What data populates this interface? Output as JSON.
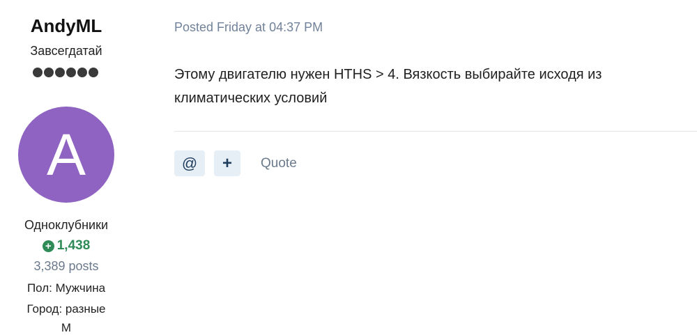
{
  "author": {
    "username": "AndyML",
    "rank": "Завсегдатай",
    "pip_count": 6,
    "avatar_letter": "A",
    "avatar_color": "#8e63c1",
    "group": "Одноклубники",
    "reputation": "1,438",
    "reputation_color": "#2e8b57",
    "posts": "3,389 posts",
    "fields": [
      {
        "label": "Пол:",
        "value": "Мужчина"
      },
      {
        "label": "Город:",
        "value": "разные"
      },
      {
        "label": "М",
        "value": ""
      }
    ]
  },
  "post": {
    "date": "Posted Friday at 04:37 PM",
    "body": "Этому двигателю нужен HTHS > 4. Вязкость выбирайте исходя из климатических условий"
  },
  "actions": {
    "mention_icon": "@",
    "multiquote_icon": "+",
    "quote_label": "Quote"
  }
}
